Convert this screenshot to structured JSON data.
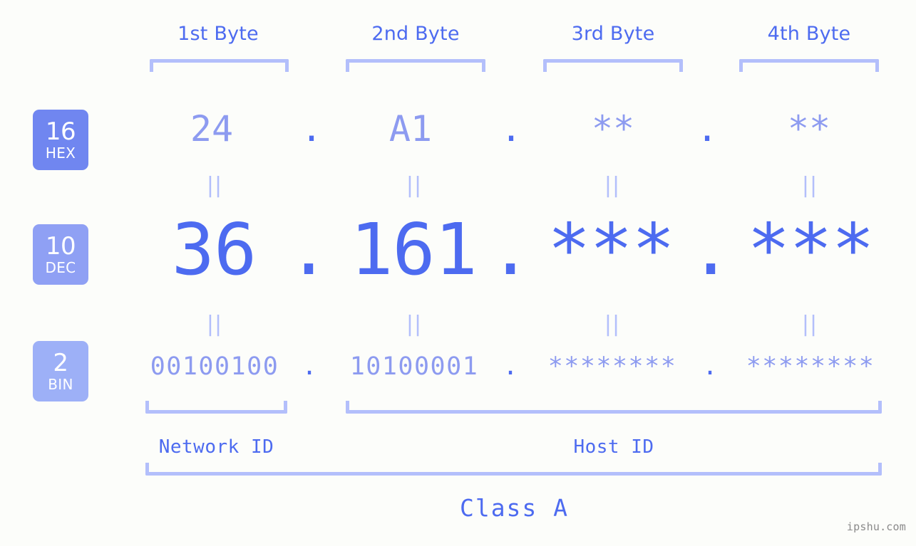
{
  "background_color": "#fcfdfa",
  "accent_color": "#4d6bf0",
  "muted_accent_color": "#8d9bf0",
  "bracket_color": "#b3bffb",
  "header": {
    "byte_labels": [
      "1st Byte",
      "2nd Byte",
      "3rd Byte",
      "4th Byte"
    ]
  },
  "radix_badges": [
    {
      "base": "16",
      "name": "HEX",
      "color": "#7086f0"
    },
    {
      "base": "10",
      "name": "DEC",
      "color": "#8fa0f4"
    },
    {
      "base": "2",
      "name": "BIN",
      "color": "#9db0f7"
    }
  ],
  "separator": ".",
  "equality_marker": "||",
  "rows": {
    "hex": {
      "label": "HEX",
      "octets": [
        "24",
        "A1",
        "**",
        "**"
      ]
    },
    "dec": {
      "label": "DEC",
      "octets": [
        "36",
        "161",
        "***",
        "***"
      ]
    },
    "bin": {
      "label": "BIN",
      "octets": [
        "00100100",
        "10100001",
        "********",
        "********"
      ]
    }
  },
  "footer": {
    "network_id_label": "Network ID",
    "host_id_label": "Host ID",
    "class_label": "Class A"
  },
  "watermark": "ipshu.com"
}
